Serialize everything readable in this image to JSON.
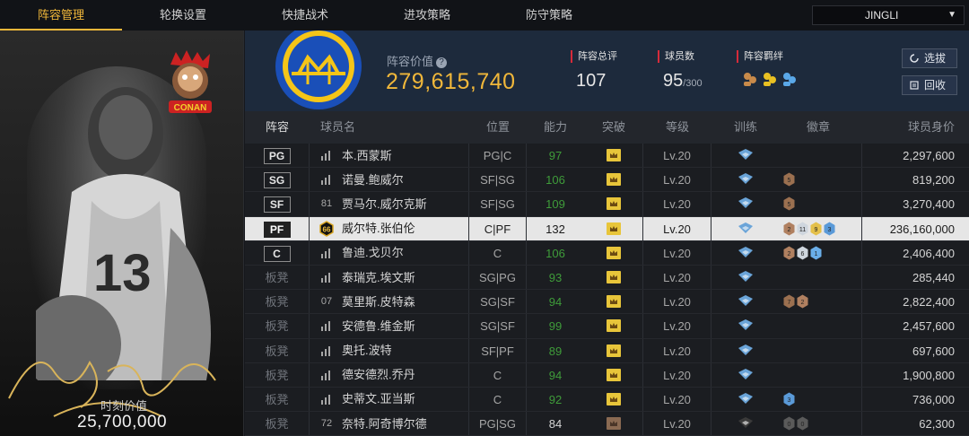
{
  "tabs": [
    "阵容管理",
    "轮换设置",
    "快捷战术",
    "进攻策略",
    "防守策略"
  ],
  "active_tab": 0,
  "team_select": {
    "value": "JINGLI"
  },
  "player_card": {
    "value_label": "时刻价值",
    "value": "25,700,000",
    "badge_text": "CONAN"
  },
  "team_info": {
    "value_label": "阵容价值",
    "value": "279,615,740",
    "rating_label": "阵容总评",
    "rating": "107",
    "count_label": "球员数",
    "count": "95",
    "count_max": "/300",
    "bond_label": "阵容羁绊",
    "btn_select": "选拔",
    "btn_recycle": "回收"
  },
  "table": {
    "headers": [
      "阵容",
      "球员名",
      "位置",
      "能力",
      "突破",
      "等级",
      "训练",
      "徽章",
      "球员身价"
    ],
    "rows": [
      {
        "slot": "PG",
        "name": "本.西蒙斯",
        "icon": "bars",
        "pos": "PG|C",
        "ability": "97",
        "green": true,
        "level": "Lv.20",
        "badges": [],
        "value": "2,297,600"
      },
      {
        "slot": "SG",
        "name": "诺曼.鲍威尔",
        "icon": "bars",
        "pos": "SF|SG",
        "ability": "106",
        "green": true,
        "level": "Lv.20",
        "badges": [
          "5"
        ],
        "value": "819,200"
      },
      {
        "slot": "SF",
        "name": "贾马尔.威尔克斯",
        "icon": "81",
        "pos": "SF|SG",
        "ability": "109",
        "green": true,
        "level": "Lv.20",
        "badges": [
          "5"
        ],
        "value": "3,270,400"
      },
      {
        "slot": "PF",
        "name": "威尔特.张伯伦",
        "icon": "66",
        "pos": "C|PF",
        "ability": "132",
        "green": false,
        "level": "Lv.20",
        "badges": [
          "2",
          "11",
          "9",
          "3"
        ],
        "value": "236,160,000",
        "selected": true
      },
      {
        "slot": "C",
        "name": "鲁迪.戈贝尔",
        "icon": "bars",
        "pos": "C",
        "ability": "106",
        "green": true,
        "level": "Lv.20",
        "badges": [
          "2",
          "6",
          "1"
        ],
        "value": "2,406,400"
      },
      {
        "slot": "板凳",
        "name": "泰瑞克.埃文斯",
        "icon": "bars",
        "pos": "SG|PG",
        "ability": "93",
        "green": true,
        "level": "Lv.20",
        "badges": [],
        "value": "285,440"
      },
      {
        "slot": "板凳",
        "name": "莫里斯.皮特森",
        "icon": "07",
        "pos": "SG|SF",
        "ability": "94",
        "green": true,
        "level": "Lv.20",
        "badges": [
          "7",
          "2"
        ],
        "value": "2,822,400"
      },
      {
        "slot": "板凳",
        "name": "安德鲁.维金斯",
        "icon": "bars",
        "pos": "SG|SF",
        "ability": "99",
        "green": true,
        "level": "Lv.20",
        "badges": [],
        "value": "2,457,600"
      },
      {
        "slot": "板凳",
        "name": "奥托.波特",
        "icon": "bars",
        "pos": "SF|PF",
        "ability": "89",
        "green": true,
        "level": "Lv.20",
        "badges": [],
        "value": "697,600"
      },
      {
        "slot": "板凳",
        "name": "德安德烈.乔丹",
        "icon": "bars",
        "pos": "C",
        "ability": "94",
        "green": true,
        "level": "Lv.20",
        "badges": [],
        "value": "1,900,800"
      },
      {
        "slot": "板凳",
        "name": "史蒂文.亚当斯",
        "icon": "bars",
        "pos": "C",
        "ability": "92",
        "green": true,
        "level": "Lv.20",
        "badges": [
          "3"
        ],
        "value": "736,000"
      },
      {
        "slot": "板凳",
        "name": "奈特.阿奇博尔德",
        "icon": "72",
        "pos": "PG|SG",
        "ability": "84",
        "green": false,
        "level": "Lv.20",
        "badges": [
          "0",
          "0"
        ],
        "value": "62,300",
        "dim": true
      }
    ]
  },
  "colors": {
    "accent": "#f0b73a",
    "green": "#3f9c3a",
    "red_marker": "#d62b3a"
  }
}
